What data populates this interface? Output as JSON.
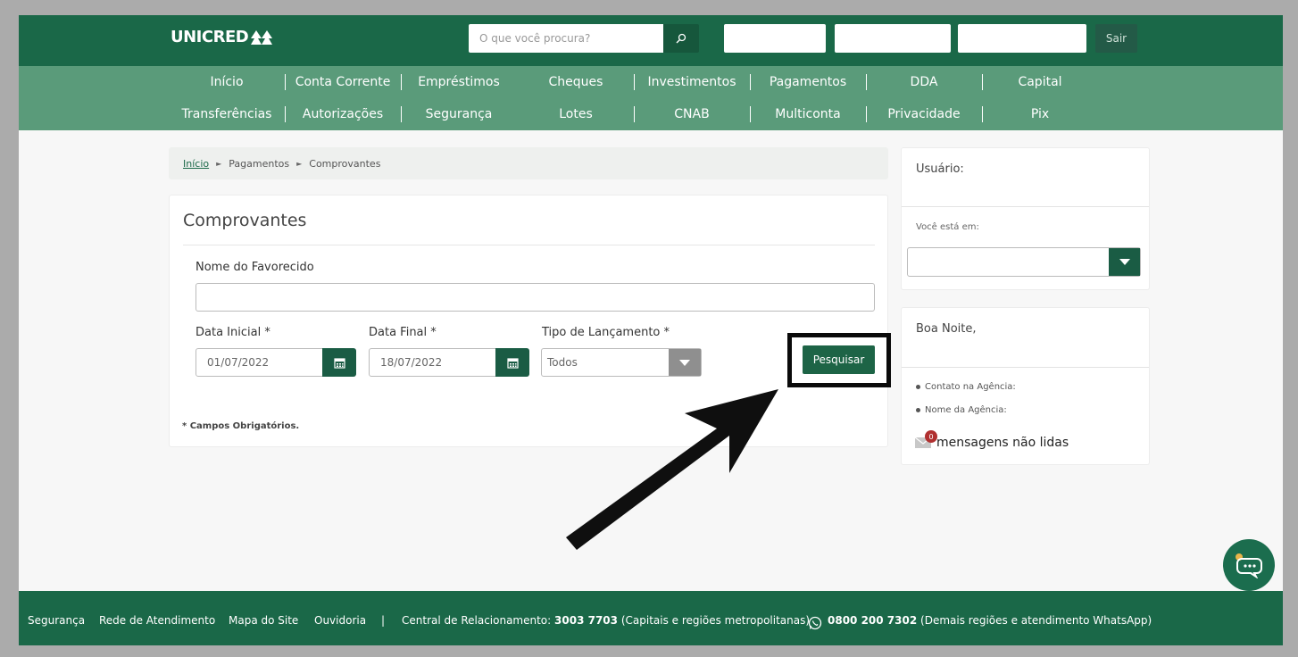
{
  "header": {
    "logo_text": "UNICRED",
    "search_placeholder": "O que você procura?",
    "logout_label": "Sair"
  },
  "nav": {
    "row1": [
      "Início",
      "Conta Corrente",
      "Empréstimos",
      "Cheques",
      "Investimentos",
      "Pagamentos",
      "DDA",
      "Capital"
    ],
    "row2": [
      "Transferências",
      "Autorizações",
      "Segurança",
      "Lotes",
      "CNAB",
      "Multiconta",
      "Privacidade",
      "Pix"
    ]
  },
  "breadcrumb": {
    "items": [
      "Início",
      "Pagamentos",
      "Comprovantes"
    ],
    "separator": "►"
  },
  "form": {
    "title": "Comprovantes",
    "nome_label": "Nome do Favorecido",
    "nome_value": "",
    "data_inicial_label": "Data Inicial *",
    "data_inicial_value": "01/07/2022",
    "data_final_label": "Data Final *",
    "data_final_value": "18/07/2022",
    "tipo_label": "Tipo de Lançamento *",
    "tipo_value": "Todos",
    "search_button": "Pesquisar",
    "required_note": "* Campos Obrigatórios."
  },
  "sidebar": {
    "user_title": "Usuário:",
    "voce_esta_em": "Você está em:",
    "greeting": "Boa Noite,",
    "contato_label": "Contato na Agência:",
    "nome_agencia_label": "Nome da Agência:",
    "unread_count": "0",
    "unread_label": "mensagens não lidas"
  },
  "footer": {
    "links": [
      "Segurança",
      "Rede de Atendimento",
      "Mapa do Site",
      "Ouvidoria"
    ],
    "divider": "|",
    "central_label": "Central de Relacionamento:",
    "central_phone": "3003 7703",
    "central_desc": "(Capitais e regiões metropolitanas)",
    "whatsapp_phone": "0800 200 7302",
    "whatsapp_desc": "(Demais regiões e atendimento WhatsApp)"
  },
  "colors": {
    "header_green": "#1a6848",
    "nav_green": "#5a9b7a",
    "button_green": "#1d6446"
  }
}
